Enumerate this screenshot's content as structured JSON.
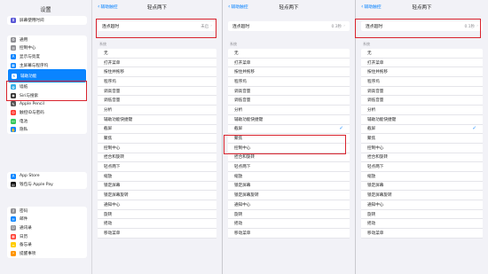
{
  "sidebar": {
    "title": "设置",
    "groups": [
      [
        {
          "label": "屏幕使用时间",
          "icon": "hourglass-icon",
          "color": "#5856d6",
          "glyph": "⧗"
        }
      ],
      [
        {
          "label": "通用",
          "icon": "gear-icon",
          "color": "#8e8e93",
          "glyph": "⚙"
        },
        {
          "label": "控制中心",
          "icon": "switches-icon",
          "color": "#8e8e93",
          "glyph": "☰"
        },
        {
          "label": "显示与亮度",
          "icon": "brightness-icon",
          "color": "#0a84ff",
          "glyph": "A"
        },
        {
          "label": "主屏幕与程序坞",
          "icon": "grid-icon",
          "color": "#0a84ff",
          "glyph": "▦"
        },
        {
          "label": "辅助功能",
          "icon": "accessibility-icon",
          "color": "#0a84ff",
          "glyph": "♿",
          "selected": true
        },
        {
          "label": "墙纸",
          "icon": "wallpaper-icon",
          "color": "#32ade6",
          "glyph": "✿"
        },
        {
          "label": "Siri与搜索",
          "icon": "siri-icon",
          "color": "#333333",
          "glyph": "◉"
        },
        {
          "label": "Apple Pencil",
          "icon": "pencil-icon",
          "color": "#555555",
          "glyph": "✎"
        },
        {
          "label": "触控ID与密码",
          "icon": "fingerprint-icon",
          "color": "#ff3b30",
          "glyph": "◎"
        },
        {
          "label": "电池",
          "icon": "battery-icon",
          "color": "#34c759",
          "glyph": "▭"
        },
        {
          "label": "隐私",
          "icon": "hand-icon",
          "color": "#0a84ff",
          "glyph": "✋"
        }
      ],
      [
        {
          "label": "App Store",
          "icon": "appstore-icon",
          "color": "#0a84ff",
          "glyph": "A"
        },
        {
          "label": "钱包与 Apple Pay",
          "icon": "wallet-icon",
          "color": "#111111",
          "glyph": "▤"
        }
      ],
      [
        {
          "label": "密码",
          "icon": "key-icon",
          "color": "#8e8e93",
          "glyph": "⚷"
        },
        {
          "label": "邮件",
          "icon": "mail-icon",
          "color": "#0a84ff",
          "glyph": "✉"
        },
        {
          "label": "通讯录",
          "icon": "contacts-icon",
          "color": "#8e8e93",
          "glyph": "☺"
        },
        {
          "label": "日历",
          "icon": "calendar-icon",
          "color": "#ff3b30",
          "glyph": "▦"
        },
        {
          "label": "备忘录",
          "icon": "notes-icon",
          "color": "#ffcc00",
          "glyph": "≡"
        },
        {
          "label": "提醒事项",
          "icon": "reminders-icon",
          "color": "#ff9500",
          "glyph": "•"
        }
      ]
    ]
  },
  "panels": [
    {
      "back": "辅助触控",
      "title": "轻点两下",
      "delay_label": "连点超时",
      "delay_value": "未启",
      "section_label": "系统",
      "options": [
        "无",
        "打开菜单",
        "按住并拖移",
        "程序坞",
        "调高音量",
        "调低音量",
        "分析",
        "辅助功能快捷键",
        "截屏",
        "聚焦",
        "控制中心",
        "捏合和旋转",
        "轻点两下",
        "缩放",
        "锁定屏幕",
        "锁定屏幕旋转",
        "通知中心",
        "旋转",
        "摇动",
        "移动菜单"
      ],
      "checked": -1
    },
    {
      "back": "辅助触控",
      "title": "轻点两下",
      "delay_label": "连点超时",
      "delay_value": "0.3秒",
      "section_label": "系统",
      "options": [
        "无",
        "打开菜单",
        "按住并拖移",
        "程序坞",
        "调高音量",
        "调低音量",
        "分析",
        "辅助功能快捷键",
        "截屏",
        "聚焦",
        "控制中心",
        "捏合和旋转",
        "轻点两下",
        "缩放",
        "锁定屏幕",
        "锁定屏幕旋转",
        "通知中心",
        "旋转",
        "摇动",
        "移动菜单"
      ],
      "checked": 8
    },
    {
      "back": "辅助触控",
      "title": "轻点两下",
      "delay_label": "连点超时",
      "delay_value": "0.1秒",
      "section_label": "系统",
      "options": [
        "无",
        "打开菜单",
        "按住并拖移",
        "程序坞",
        "调高音量",
        "调低音量",
        "分析",
        "辅助功能快捷键",
        "截屏",
        "聚焦",
        "控制中心",
        "捏合和旋转",
        "轻点两下",
        "缩放",
        "锁定屏幕",
        "锁定屏幕旋转",
        "通知中心",
        "旋转",
        "摇动",
        "移动菜单"
      ],
      "checked": 8
    }
  ],
  "colors": {
    "accent": "#0a84ff",
    "highlight": "#d9232d",
    "background": "#f2f2f7"
  }
}
